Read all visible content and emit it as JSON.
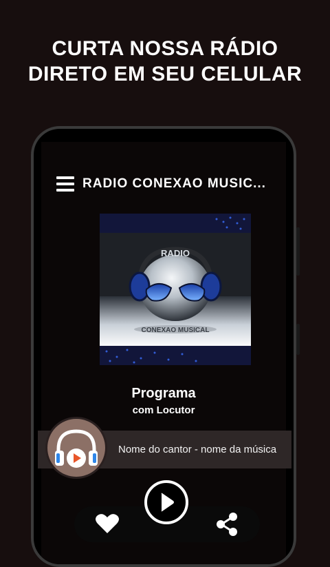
{
  "promo": {
    "line1": "CURTA NOSSA RÁDIO",
    "line2": "DIRETO EM SEU CELULAR"
  },
  "app": {
    "title": "RADIO CONEXAO MUSIC..."
  },
  "cover": {
    "top_text": "RADIO",
    "bottom_text": "CONEXAO MUSICAL"
  },
  "program": {
    "title": "Programa",
    "subtitle": "com Locutor"
  },
  "now_playing": {
    "text": "Nome do cantor - nome da música"
  },
  "icons": {
    "menu": "hamburger-menu-icon",
    "headphones": "headphones-play-icon",
    "play": "play-icon",
    "favorite": "heart-icon",
    "share": "share-icon"
  },
  "colors": {
    "background": "#170e0e",
    "accent": "#e8562a",
    "now_playing_bar": "#2e2727",
    "avatar_circle": "#8c7066"
  }
}
